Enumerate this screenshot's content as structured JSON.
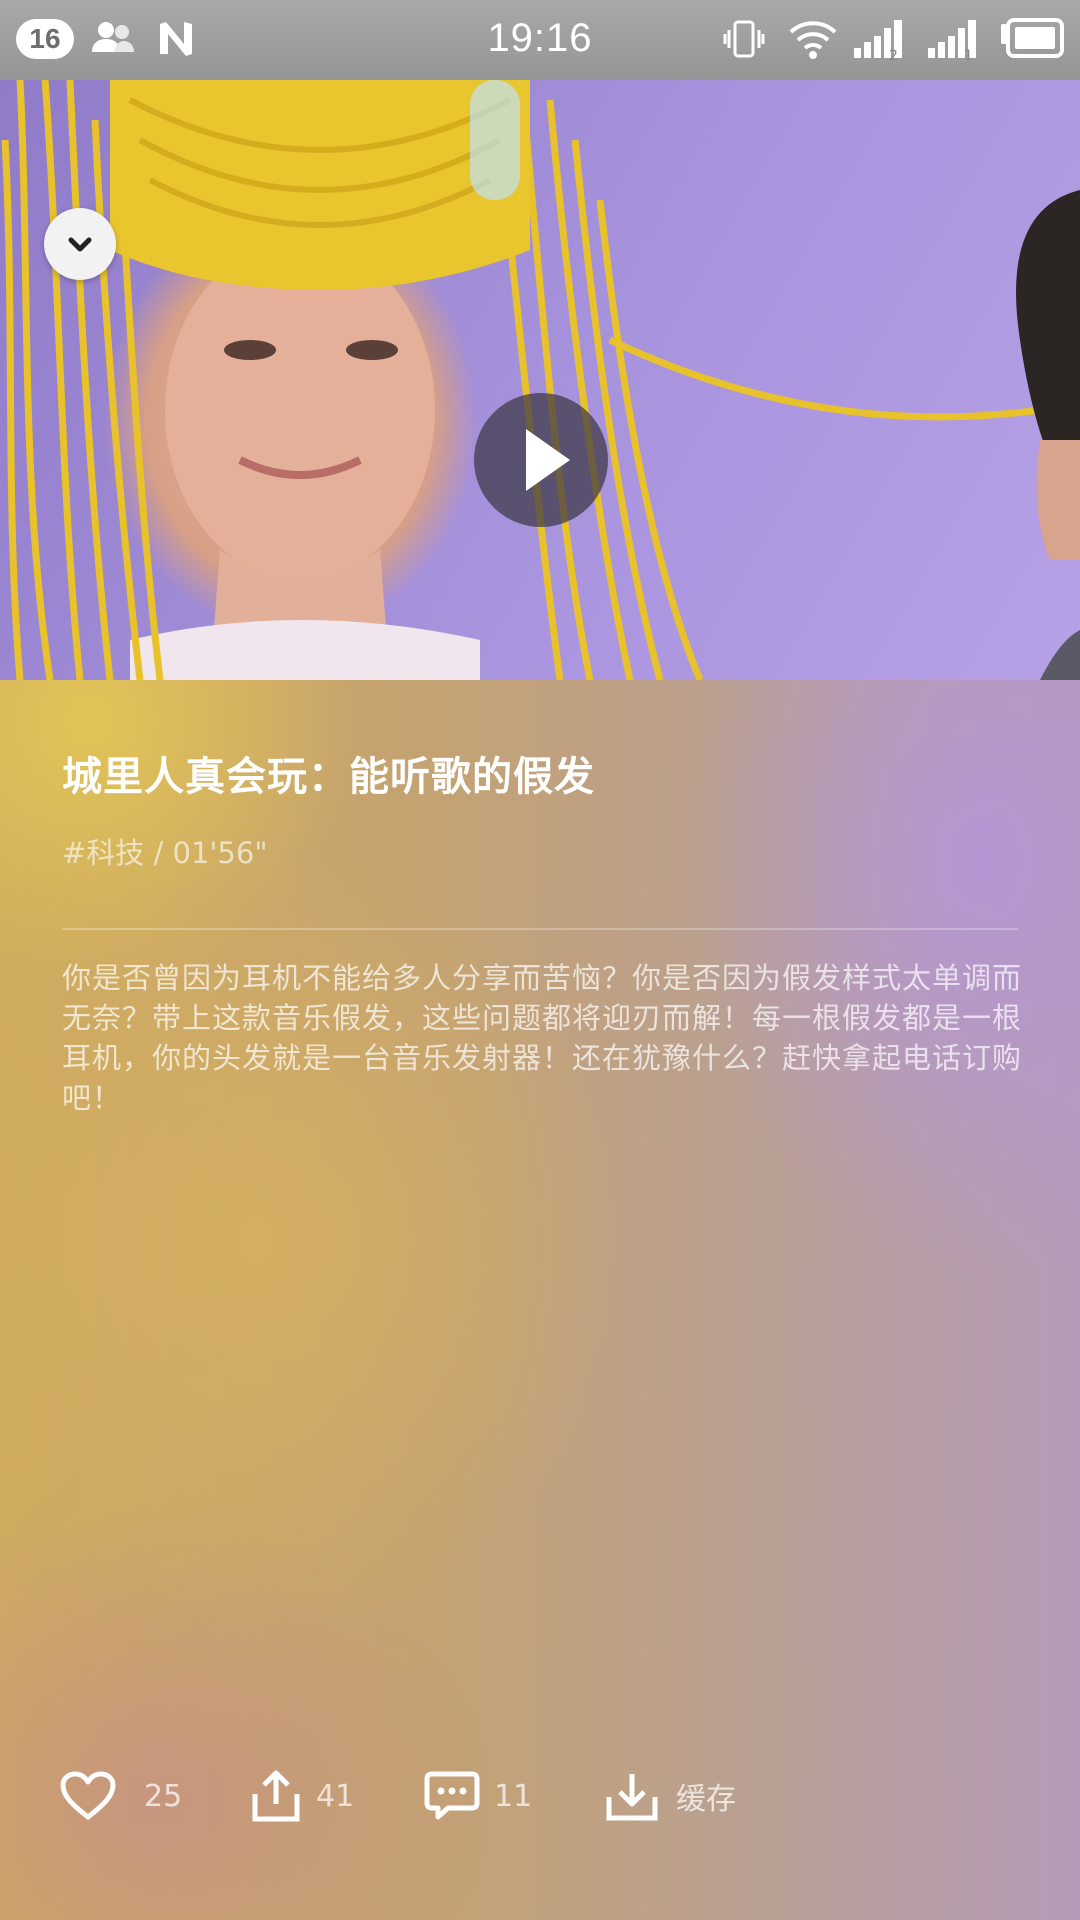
{
  "status_bar": {
    "notification_count": "16",
    "time": "19:16"
  },
  "video": {
    "collapse_icon": "chevron-down-icon",
    "play_icon": "play-icon"
  },
  "article": {
    "title": "城里人真会玩：能听歌的假发",
    "meta": "#科技 / 01'56\"",
    "description": "你是否曾因为耳机不能给多人分享而苦恼？你是否因为假发样式太单调而无奈？带上这款音乐假发，这些问题都将迎刃而解！每一根假发都是一根耳机，你的头发就是一台音乐发射器！还在犹豫什么？赶快拿起电话订购吧！"
  },
  "actions": {
    "like_count": "25",
    "share_count": "41",
    "comment_count": "11",
    "download_label": "缓存"
  }
}
